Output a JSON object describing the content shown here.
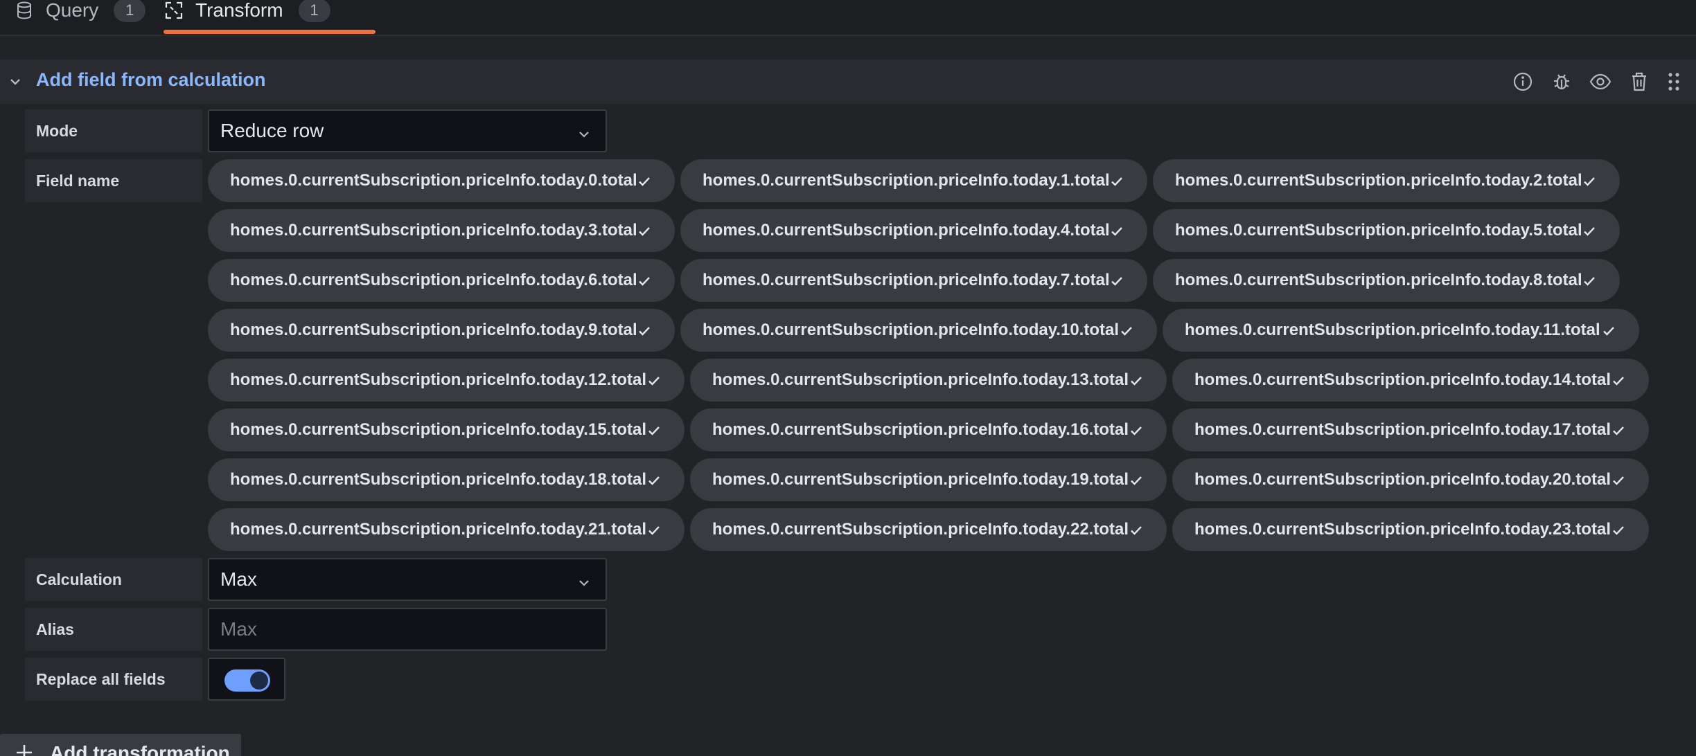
{
  "tabs": [
    {
      "label": "Query",
      "count": "1",
      "icon": "database-icon"
    },
    {
      "label": "Transform",
      "count": "1",
      "icon": "transform-icon"
    }
  ],
  "transformation": {
    "title": "Add field from calculation",
    "header_icons": [
      "info-icon",
      "debug-icon",
      "eye-icon",
      "trash-icon",
      "drag-handle-icon"
    ]
  },
  "form": {
    "mode_label": "Mode",
    "mode_value": "Reduce row",
    "field_name_label": "Field name",
    "fields": [
      "homes.0.currentSubscription.priceInfo.today.0.total",
      "homes.0.currentSubscription.priceInfo.today.1.total",
      "homes.0.currentSubscription.priceInfo.today.2.total",
      "homes.0.currentSubscription.priceInfo.today.3.total",
      "homes.0.currentSubscription.priceInfo.today.4.total",
      "homes.0.currentSubscription.priceInfo.today.5.total",
      "homes.0.currentSubscription.priceInfo.today.6.total",
      "homes.0.currentSubscription.priceInfo.today.7.total",
      "homes.0.currentSubscription.priceInfo.today.8.total",
      "homes.0.currentSubscription.priceInfo.today.9.total",
      "homes.0.currentSubscription.priceInfo.today.10.total",
      "homes.0.currentSubscription.priceInfo.today.11.total",
      "homes.0.currentSubscription.priceInfo.today.12.total",
      "homes.0.currentSubscription.priceInfo.today.13.total",
      "homes.0.currentSubscription.priceInfo.today.14.total",
      "homes.0.currentSubscription.priceInfo.today.15.total",
      "homes.0.currentSubscription.priceInfo.today.16.total",
      "homes.0.currentSubscription.priceInfo.today.17.total",
      "homes.0.currentSubscription.priceInfo.today.18.total",
      "homes.0.currentSubscription.priceInfo.today.19.total",
      "homes.0.currentSubscription.priceInfo.today.20.total",
      "homes.0.currentSubscription.priceInfo.today.21.total",
      "homes.0.currentSubscription.priceInfo.today.22.total",
      "homes.0.currentSubscription.priceInfo.today.23.total"
    ],
    "calculation_label": "Calculation",
    "calculation_value": "Max",
    "alias_label": "Alias",
    "alias_value": "",
    "alias_placeholder": "Max",
    "replace_label": "Replace all fields",
    "replace_enabled": true
  },
  "add_transformation_label": "Add transformation",
  "colors": {
    "accent_blue": "#8ab8ff",
    "tab_underline": "#f0703a",
    "toggle_on": "#6e9fff"
  }
}
